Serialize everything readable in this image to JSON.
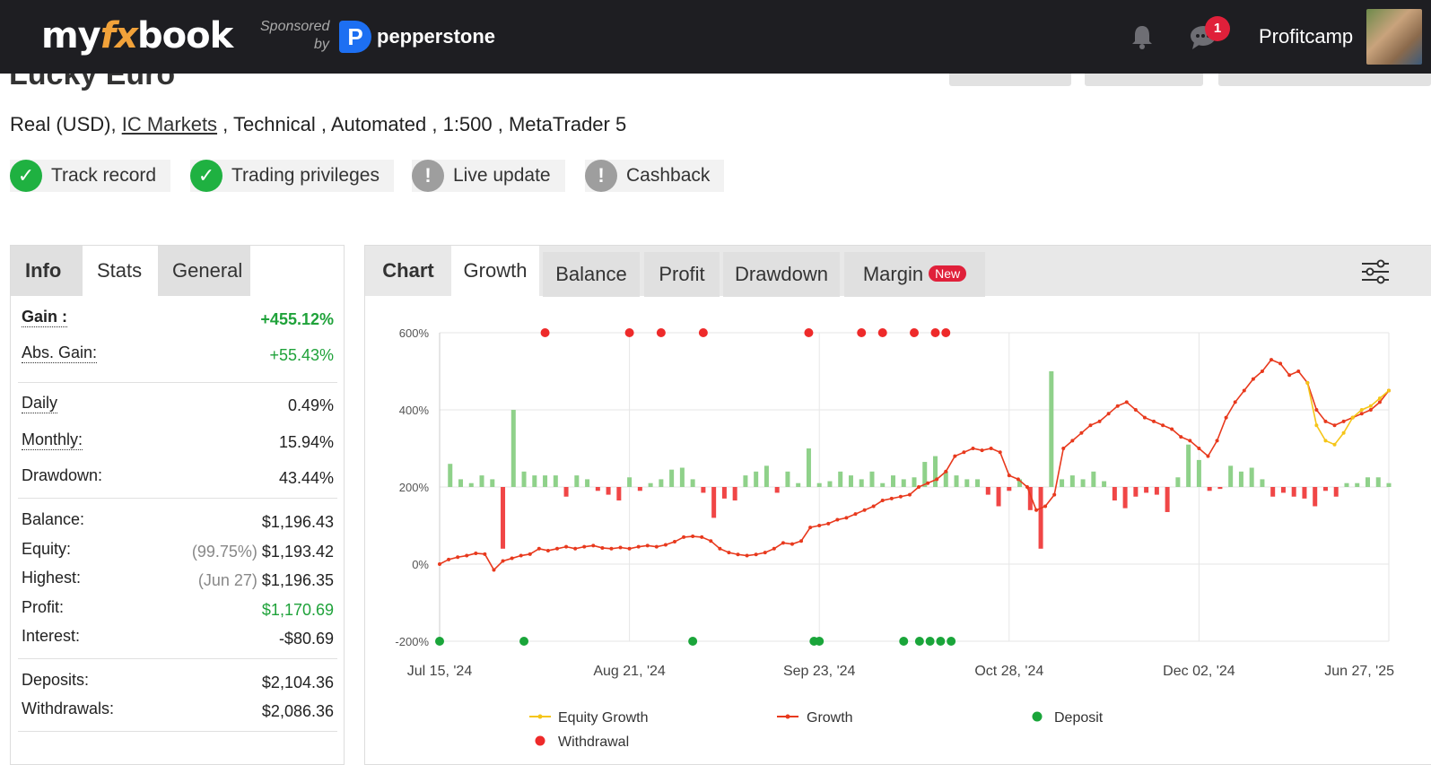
{
  "topbar": {
    "logo_my": "my",
    "logo_fx": "fx",
    "logo_book": "book",
    "sponsored": "Sponsored",
    "by": "by",
    "sponsor_mark": "P",
    "sponsor_name": "pepperstone",
    "notification_count": "1",
    "username": "Profitcamp"
  },
  "header": {
    "title": "Lucky Euro",
    "account_type": "Real (USD),",
    "broker": "IC Markets",
    "details": " , Technical , Automated , 1:500 , MetaTrader 5"
  },
  "verifications": [
    {
      "label": "Track record",
      "status": "ok",
      "icon": "check-icon"
    },
    {
      "label": "Trading privileges",
      "status": "ok",
      "icon": "check-icon"
    },
    {
      "label": "Live update",
      "status": "warn",
      "icon": "exclamation-icon"
    },
    {
      "label": "Cashback",
      "status": "warn",
      "icon": "exclamation-icon"
    }
  ],
  "info_tabs": [
    "Info",
    "Stats",
    "General"
  ],
  "stats": {
    "gain": {
      "label": "Gain :",
      "value": "+455.12%"
    },
    "abs_gain": {
      "label": "Abs. Gain:",
      "value": "+55.43%"
    },
    "daily": {
      "label": "Daily",
      "value": "0.49%"
    },
    "monthly": {
      "label": "Monthly:",
      "value": "15.94%"
    },
    "drawdown": {
      "label": "Drawdown:",
      "value": "43.44%"
    },
    "balance": {
      "label": "Balance:",
      "value": "$1,196.43"
    },
    "equity": {
      "label": "Equity:",
      "paren": "(99.75%)",
      "value": "$1,193.42"
    },
    "highest": {
      "label": "Highest:",
      "paren": "(Jun 27)",
      "value": "$1,196.35"
    },
    "profit": {
      "label": "Profit:",
      "value": "$1,170.69"
    },
    "interest": {
      "label": "Interest:",
      "value": "-$80.69"
    },
    "deposits": {
      "label": "Deposits:",
      "value": "$2,104.36"
    },
    "withdrawals": {
      "label": "Withdrawals:",
      "value": "$2,086.36"
    }
  },
  "chart_tabs": {
    "chart": "Chart",
    "growth": "Growth",
    "balance": "Balance",
    "profit": "Profit",
    "drawdown": "Drawdown",
    "margin": "Margin",
    "new_badge": "New"
  },
  "colors": {
    "growth": "#e8391d",
    "equity": "#f5c518",
    "bar_positive": "#8fd18a",
    "bar_negative": "#f04646",
    "deposit": "#1aa53a",
    "withdrawal": "#ee2a2a"
  },
  "chart_data": {
    "type": "line",
    "ylim": [
      -200,
      600
    ],
    "y_ticks": [
      "600%",
      "400%",
      "200%",
      "0%",
      "-200%"
    ],
    "y_tick_values": [
      600,
      400,
      200,
      0,
      -200
    ],
    "x_ticks": [
      "Jul 15, '24",
      "Aug 21, '24",
      "Sep 23, '24",
      "Oct 28, '24",
      "Dec 02, '24",
      "Jun 27, '25"
    ],
    "legend": [
      "Equity Growth",
      "Growth",
      "Deposit",
      "Withdrawal"
    ],
    "n_points": 106,
    "growth": [
      0,
      12,
      18,
      22,
      28,
      26,
      -15,
      8,
      15,
      22,
      26,
      40,
      35,
      40,
      45,
      40,
      45,
      48,
      42,
      40,
      43,
      40,
      45,
      48,
      45,
      50,
      58,
      70,
      72,
      70,
      60,
      40,
      30,
      25,
      22,
      25,
      30,
      40,
      55,
      52,
      60,
      95,
      100,
      105,
      115,
      120,
      130,
      140,
      150,
      165,
      170,
      175,
      180,
      200,
      210,
      220,
      240,
      280,
      290,
      300,
      295,
      300,
      290,
      230,
      220,
      200,
      140,
      150,
      180,
      300,
      320,
      340,
      360,
      370,
      390,
      410,
      420,
      400,
      380,
      370,
      360,
      350,
      330,
      320,
      300,
      280,
      320,
      380,
      420,
      450,
      480,
      500,
      530,
      520,
      490,
      500,
      470,
      400,
      370,
      360,
      370,
      380,
      390,
      400,
      420,
      450
    ],
    "equity_growth": [
      null,
      null,
      null,
      null,
      null,
      null,
      null,
      null,
      null,
      null,
      null,
      null,
      null,
      null,
      null,
      null,
      null,
      null,
      null,
      null,
      null,
      null,
      null,
      null,
      null,
      null,
      null,
      null,
      null,
      null,
      null,
      null,
      null,
      null,
      null,
      null,
      null,
      null,
      null,
      null,
      null,
      null,
      null,
      null,
      null,
      null,
      null,
      null,
      null,
      null,
      null,
      null,
      null,
      null,
      null,
      null,
      null,
      null,
      null,
      null,
      null,
      null,
      null,
      null,
      null,
      null,
      null,
      null,
      null,
      null,
      null,
      null,
      null,
      null,
      null,
      null,
      null,
      null,
      null,
      null,
      null,
      null,
      null,
      null,
      null,
      null,
      null,
      null,
      null,
      null,
      null,
      null,
      null,
      null,
      null,
      null,
      470,
      360,
      320,
      310,
      340,
      380,
      400,
      410,
      430,
      450
    ],
    "bars": [
      {
        "i": 1,
        "v": 60
      },
      {
        "i": 2,
        "v": 20
      },
      {
        "i": 3,
        "v": 10
      },
      {
        "i": 4,
        "v": 30
      },
      {
        "i": 5,
        "v": 20
      },
      {
        "i": 6,
        "v": -160
      },
      {
        "i": 7,
        "v": 200
      },
      {
        "i": 8,
        "v": 40
      },
      {
        "i": 9,
        "v": 30
      },
      {
        "i": 10,
        "v": 30
      },
      {
        "i": 11,
        "v": 30
      },
      {
        "i": 12,
        "v": -25
      },
      {
        "i": 13,
        "v": 30
      },
      {
        "i": 14,
        "v": 20
      },
      {
        "i": 15,
        "v": -10
      },
      {
        "i": 16,
        "v": -20
      },
      {
        "i": 17,
        "v": -35
      },
      {
        "i": 18,
        "v": 25
      },
      {
        "i": 19,
        "v": -10
      },
      {
        "i": 20,
        "v": 10
      },
      {
        "i": 21,
        "v": 20
      },
      {
        "i": 22,
        "v": 45
      },
      {
        "i": 23,
        "v": 50
      },
      {
        "i": 24,
        "v": 20
      },
      {
        "i": 25,
        "v": -15
      },
      {
        "i": 26,
        "v": -80
      },
      {
        "i": 27,
        "v": -30
      },
      {
        "i": 28,
        "v": -35
      },
      {
        "i": 29,
        "v": 30
      },
      {
        "i": 30,
        "v": 40
      },
      {
        "i": 31,
        "v": 55
      },
      {
        "i": 32,
        "v": -15
      },
      {
        "i": 33,
        "v": 40
      },
      {
        "i": 34,
        "v": 10
      },
      {
        "i": 35,
        "v": 100
      },
      {
        "i": 36,
        "v": 10
      },
      {
        "i": 37,
        "v": 15
      },
      {
        "i": 38,
        "v": 40
      },
      {
        "i": 39,
        "v": 30
      },
      {
        "i": 40,
        "v": 20
      },
      {
        "i": 41,
        "v": 40
      },
      {
        "i": 42,
        "v": 10
      },
      {
        "i": 43,
        "v": 30
      },
      {
        "i": 44,
        "v": 20
      },
      {
        "i": 45,
        "v": 25
      },
      {
        "i": 46,
        "v": 65
      },
      {
        "i": 47,
        "v": 80
      },
      {
        "i": 48,
        "v": 40
      },
      {
        "i": 49,
        "v": 30
      },
      {
        "i": 50,
        "v": 20
      },
      {
        "i": 51,
        "v": 20
      },
      {
        "i": 52,
        "v": -20
      },
      {
        "i": 53,
        "v": -50
      },
      {
        "i": 54,
        "v": -10
      },
      {
        "i": 55,
        "v": 20
      },
      {
        "i": 56,
        "v": -60
      },
      {
        "i": 57,
        "v": -160
      },
      {
        "i": 58,
        "v": 300
      },
      {
        "i": 59,
        "v": 20
      },
      {
        "i": 60,
        "v": 30
      },
      {
        "i": 61,
        "v": 20
      },
      {
        "i": 62,
        "v": 40
      },
      {
        "i": 63,
        "v": 15
      },
      {
        "i": 64,
        "v": -35
      },
      {
        "i": 65,
        "v": -55
      },
      {
        "i": 66,
        "v": -25
      },
      {
        "i": 67,
        "v": -15
      },
      {
        "i": 68,
        "v": -20
      },
      {
        "i": 69,
        "v": -65
      },
      {
        "i": 70,
        "v": 25
      },
      {
        "i": 71,
        "v": 110
      },
      {
        "i": 72,
        "v": 70
      },
      {
        "i": 73,
        "v": -10
      },
      {
        "i": 74,
        "v": -5
      },
      {
        "i": 75,
        "v": 55
      },
      {
        "i": 76,
        "v": 40
      },
      {
        "i": 77,
        "v": 50
      },
      {
        "i": 78,
        "v": 20
      },
      {
        "i": 79,
        "v": -25
      },
      {
        "i": 80,
        "v": -15
      },
      {
        "i": 81,
        "v": -25
      },
      {
        "i": 82,
        "v": -30
      },
      {
        "i": 83,
        "v": -50
      },
      {
        "i": 84,
        "v": -10
      },
      {
        "i": 85,
        "v": -25
      },
      {
        "i": 86,
        "v": 10
      },
      {
        "i": 87,
        "v": 10
      },
      {
        "i": 88,
        "v": 25
      },
      {
        "i": 89,
        "v": 25
      },
      {
        "i": 90,
        "v": 10
      }
    ],
    "withdrawal_markers": [
      10,
      18,
      21,
      25,
      35,
      40,
      42,
      45,
      47,
      48
    ],
    "deposit_markers": [
      0,
      8,
      24,
      35.5,
      36,
      44,
      45.5,
      46.5,
      47.5,
      48.5
    ]
  }
}
